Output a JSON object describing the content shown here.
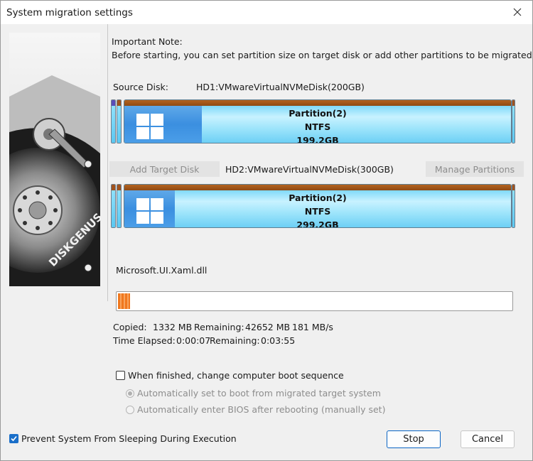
{
  "window": {
    "title": "System migration settings",
    "close_icon": "close-icon"
  },
  "note": {
    "heading": "Important Note:",
    "text": "Before starting, you can set partition size on target disk or add other partitions to be migrated."
  },
  "side_image": {
    "brand": "DISKGENUS"
  },
  "source": {
    "label": "Source Disk:",
    "disk": "HD1:VMwareVirtualNVMeDisk(200GB)",
    "partition": {
      "name": "Partition(2)",
      "fs": "NTFS",
      "size": "199.2GB",
      "used_fraction": 0.2
    }
  },
  "target": {
    "add_button": "Add Target Disk",
    "disk": "HD2:VMwareVirtualNVMeDisk(300GB)",
    "manage_button": "Manage Partitions",
    "partition": {
      "name": "Partition(2)",
      "fs": "NTFS",
      "size": "299.2GB",
      "used_fraction": 0.13
    }
  },
  "progress": {
    "current_file": "Microsoft.UI.Xaml.dll",
    "fraction": 0.03,
    "copied_label": "Copied:",
    "copied_value": "1332 MB",
    "remaining_label": "Remaining:",
    "remaining_value": "42652 MB",
    "speed": "181 MB/s",
    "elapsed_label": "Time Elapsed:",
    "elapsed_value": "0:00:07",
    "time_remaining_label": "Remaining:",
    "time_remaining_value": "0:03:55"
  },
  "options": {
    "boot_change": {
      "label": "When finished, change computer boot sequence",
      "checked": false
    },
    "radio_auto": {
      "label": "Automatically set to boot from migrated target system",
      "selected": true
    },
    "radio_bios": {
      "label": "Automatically enter BIOS after rebooting (manually set)",
      "selected": false
    },
    "prevent_sleep": {
      "label": "Prevent System From Sleeping During Execution",
      "checked": true
    }
  },
  "buttons": {
    "stop": "Stop",
    "cancel": "Cancel"
  },
  "colors": {
    "accent": "#0a64c4",
    "partition_brown": "#a0521d",
    "partition_blue": "#3b8fe0",
    "partition_free": "#9fe3f9",
    "progress": "#f0781e"
  }
}
